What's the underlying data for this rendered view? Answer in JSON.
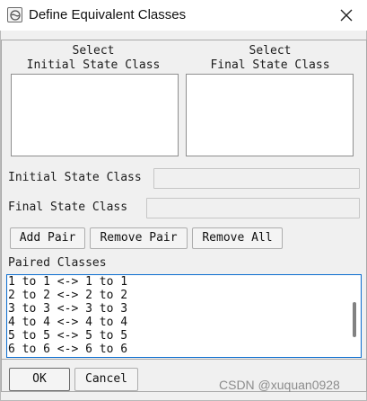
{
  "window": {
    "title": "Define Equivalent Classes",
    "icon": "app-icon",
    "close_icon": "close-icon"
  },
  "select": {
    "initial_header_line1": "Select",
    "initial_header_line2": "Initial State Class",
    "final_header_line1": "Select",
    "final_header_line2": "Final State Class",
    "initial_items": [],
    "final_items": []
  },
  "fields": {
    "initial_label": "Initial State Class",
    "initial_value": "",
    "final_label": "Final State Class",
    "final_value": ""
  },
  "buttons": {
    "add_pair": "Add Pair",
    "remove_pair": "Remove Pair",
    "remove_all": "Remove All",
    "ok": "OK",
    "cancel": "Cancel"
  },
  "paired": {
    "label": "Paired Classes",
    "items": [
      "1 to 1 <-> 1 to 1",
      "2 to 2 <-> 2 to 2",
      "3 to 3 <-> 3 to 3",
      "4 to 4 <-> 4 to 4",
      "5 to 5 <-> 5 to 5",
      "6 to 6 <-> 6 to 6"
    ]
  },
  "watermark": "CSDN @xuquan0928",
  "colors": {
    "dialog_bg": "#f0f0f0",
    "focus_border": "#0a6ccf",
    "watermark": "#8c8c8c"
  }
}
